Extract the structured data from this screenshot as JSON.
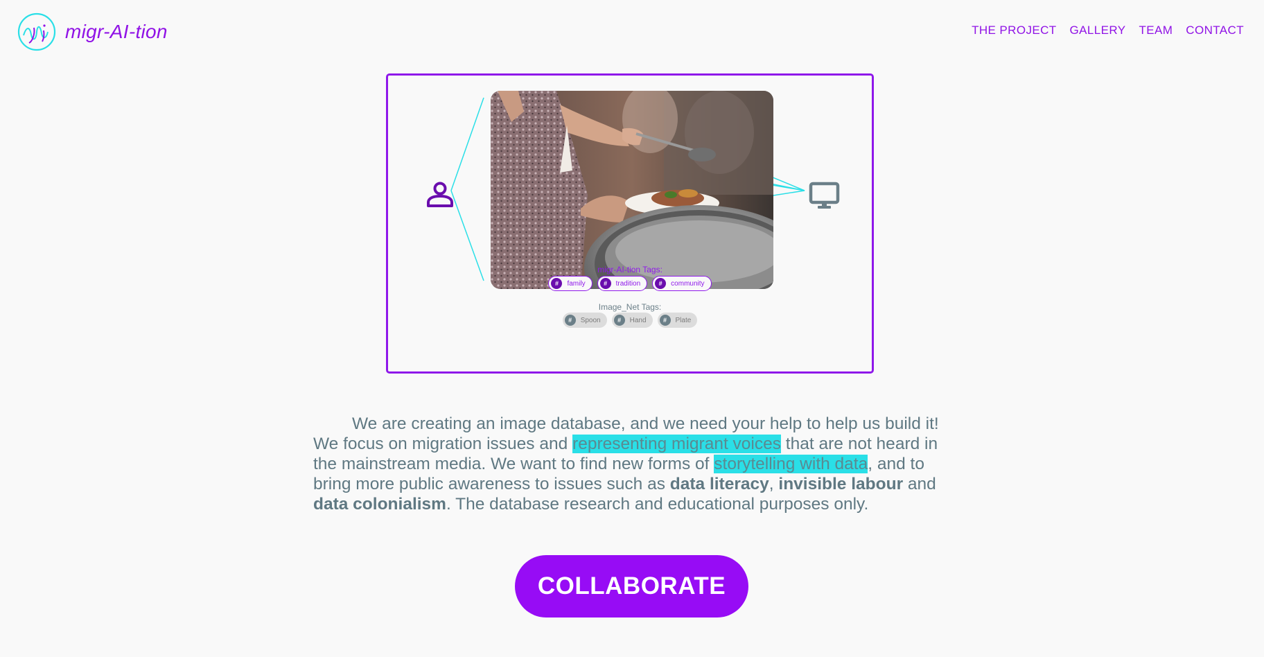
{
  "brand": {
    "name": "migr-AI-tion",
    "accent": "#9012e6",
    "highlight": "#2adfe7",
    "text_color": "#5f7882"
  },
  "nav": {
    "items": [
      "THE PROJECT",
      "GALLERY",
      "TEAM",
      "CONTACT"
    ]
  },
  "hero": {
    "person_icon": "person-icon",
    "computer_icon": "monitor-icon",
    "migr_tags_title": "migr-AI-tion Tags:",
    "migr_tags": [
      "family",
      "tradition",
      "community"
    ],
    "imagenet_tags_title": "Image_Net Tags:",
    "imagenet_tags": [
      "Spoon",
      "Hand",
      "Plate"
    ]
  },
  "description": {
    "part1": "We are creating an image database, and we need your help to help us build it! We focus on migration issues and ",
    "highlight1": "representing migrant voices",
    "part2": " that are not heard in the mainstream media. We want to find new forms of ",
    "highlight2": "storytelling with data",
    "part3": ", and to bring more public awareness to issues such as ",
    "bold1": "data literacy",
    "sep1": ", ",
    "bold2": "invisible labour",
    "part4": " and ",
    "bold3": "data colonialism",
    "part5": ". The database research and educational purposes only."
  },
  "cta": {
    "label": "COLLABORATE"
  }
}
